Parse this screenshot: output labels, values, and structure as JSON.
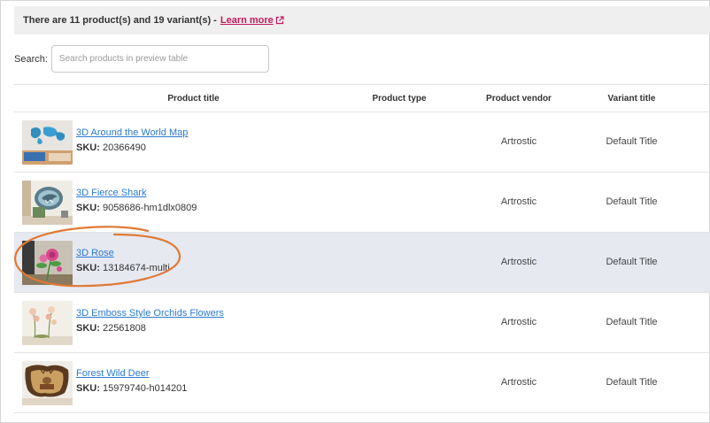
{
  "banner": {
    "text": "There are 11 product(s) and 19 variant(s) - ",
    "link": "Learn more"
  },
  "search": {
    "label": "Search:",
    "placeholder": "Search products in preview table"
  },
  "table": {
    "headers": {
      "title": "Product title",
      "type": "Product type",
      "vendor": "Product vendor",
      "variant": "Variant title"
    },
    "sku_label": "SKU:",
    "rows": [
      {
        "name": "3D Around the World Map",
        "sku": "20366490",
        "type": "",
        "vendor": "Artrostic",
        "variant": "Default Title",
        "thumb": "world-map-wall-decal"
      },
      {
        "name": "3D Fierce Shark",
        "sku": "9058686-hm1dlx0809",
        "type": "",
        "vendor": "Artrostic",
        "variant": "Default Title",
        "thumb": "shark-wall-decal"
      },
      {
        "name": "3D Rose",
        "sku": "13184674-multi",
        "type": "",
        "vendor": "Artrostic",
        "variant": "Default Title",
        "thumb": "rose-wall-decal"
      },
      {
        "name": "3D Emboss Style Orchids Flowers",
        "sku": "22561808",
        "type": "",
        "vendor": "Artrostic",
        "variant": "Default Title",
        "thumb": "orchid-wall-decal"
      },
      {
        "name": "Forest Wild Deer",
        "sku": "15979740-h014201",
        "type": "",
        "vendor": "Artrostic",
        "variant": "Default Title",
        "thumb": "deer-wall-decal"
      }
    ]
  },
  "colors": {
    "link": "#2b7bd0",
    "learn_more": "#c2185b",
    "highlight_row": "#e7e9f1",
    "annotation": "#e07a35"
  }
}
